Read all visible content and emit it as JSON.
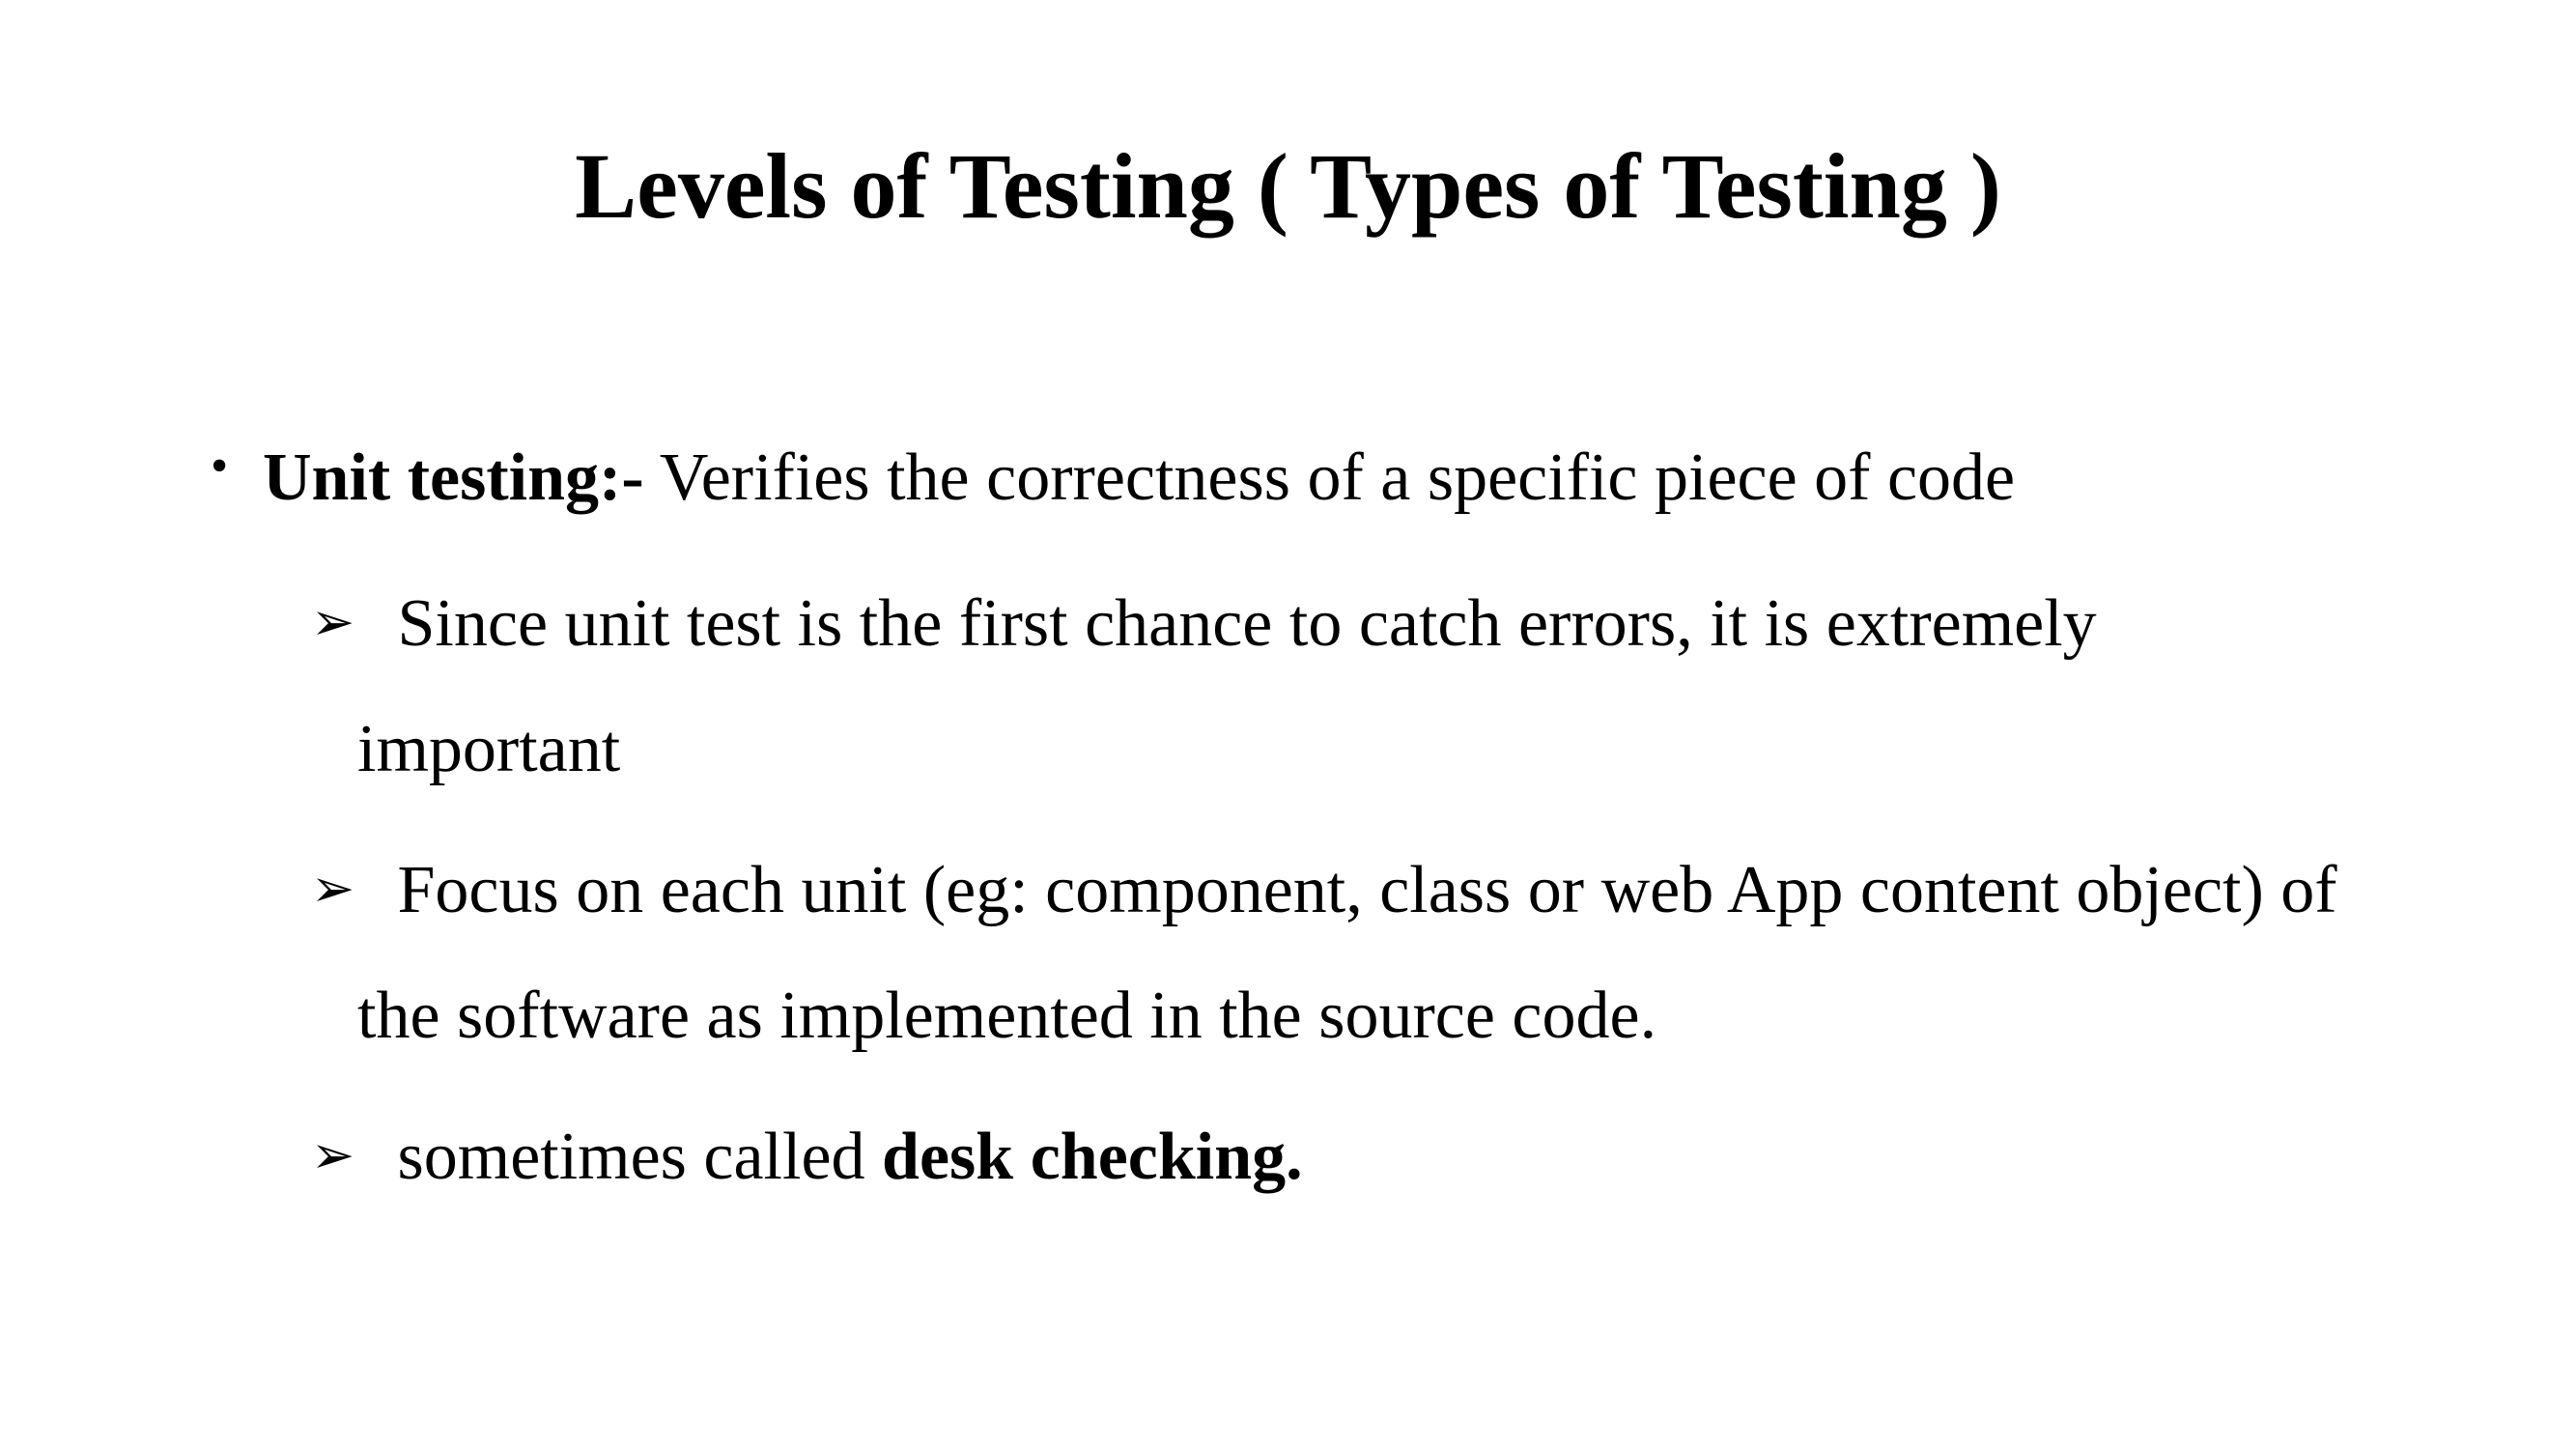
{
  "slide": {
    "title": "Levels of Testing ( Types of Testing )",
    "bullet": {
      "symbol": "•",
      "term": "Unit testing:-",
      "text": " Verifies the correctness of a specific piece of code"
    },
    "sub_items": [
      {
        "arrow": "➢",
        "line1": " Since unit test is the first chance to catch errors, it is extremely",
        "line2": "important"
      },
      {
        "arrow": "➢",
        "line1": " Focus on each unit (eg: component, class or web App content object) of",
        "line2": "the software as implemented in the source code."
      },
      {
        "arrow": "➢",
        "prefix": " sometimes called ",
        "bold": "desk checking."
      }
    ]
  }
}
